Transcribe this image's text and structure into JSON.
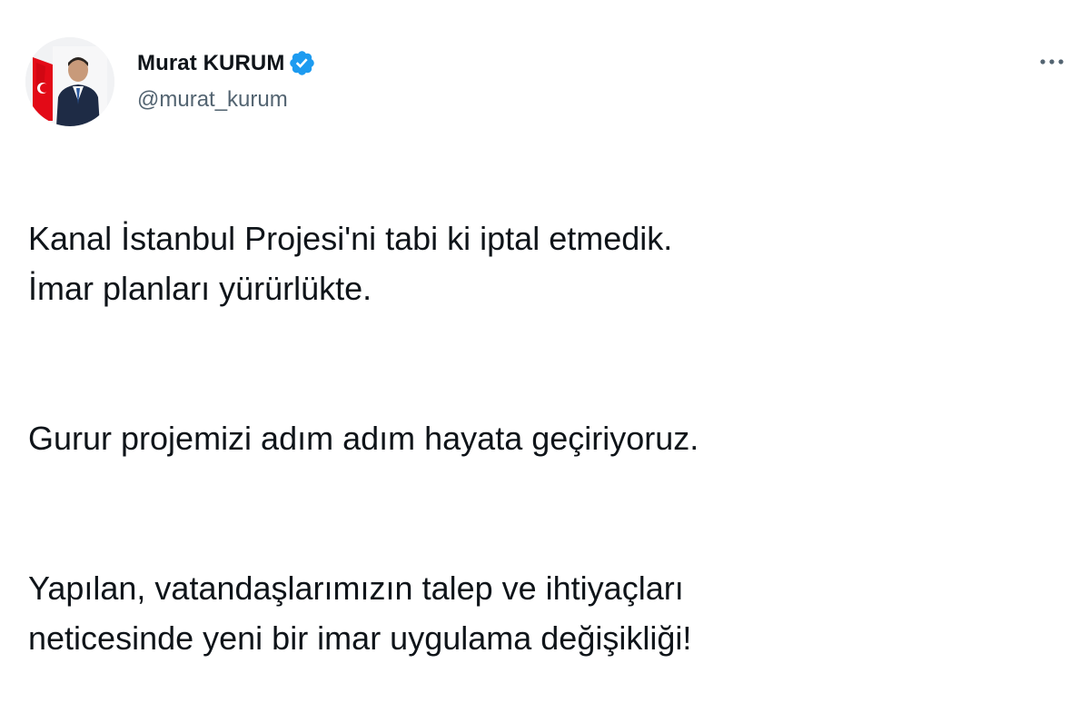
{
  "author": {
    "display_name": "Murat KURUM",
    "handle": "@murat_kurum",
    "verified_icon": "verified-badge-icon",
    "avatar_icon": "profile-photo"
  },
  "actions": {
    "more_icon": "more-horizontal-icon"
  },
  "tweet": {
    "paragraphs": [
      "Kanal İstanbul Projesi'ni tabi ki iptal etmedik.\nİmar planları yürürlükte.",
      "Gurur projemizi adım adım hayata geçiriyoruz.",
      "Yapılan, vatandaşlarımızın talep ve ihtiyaçları\nneticesinde yeni bir imar uygulama değişikliği!"
    ]
  },
  "colors": {
    "text": "#0f1419",
    "secondary": "#536471",
    "verified_blue": "#1d9bf0",
    "flag_red": "#e30a17"
  }
}
